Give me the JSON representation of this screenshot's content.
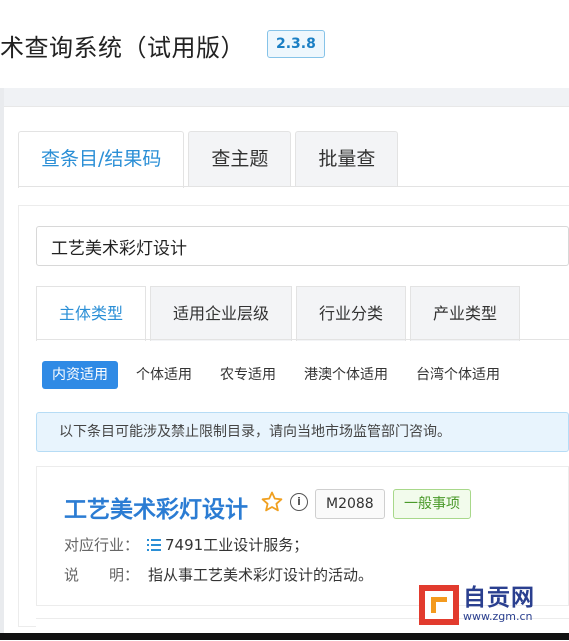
{
  "header": {
    "title": "术查询系统（试用版）",
    "version": "2.3.8"
  },
  "main_tabs": [
    {
      "label": "查条目/结果码",
      "active": true
    },
    {
      "label": "查主题",
      "active": false
    },
    {
      "label": "批量查",
      "active": false
    }
  ],
  "search": {
    "value": "工艺美术彩灯设计"
  },
  "sub_tabs": [
    {
      "label": "主体类型",
      "active": true
    },
    {
      "label": "适用企业层级",
      "active": false
    },
    {
      "label": "行业分类",
      "active": false
    },
    {
      "label": "产业类型",
      "active": false
    }
  ],
  "pills": [
    {
      "label": "内资适用",
      "active": true
    },
    {
      "label": "个体适用",
      "active": false
    },
    {
      "label": "农专适用",
      "active": false
    },
    {
      "label": "港澳个体适用",
      "active": false
    },
    {
      "label": "台湾个体适用",
      "active": false
    }
  ],
  "notice": "以下条目可能涉及禁止限制目录，请向当地市场监管部门咨询。",
  "result": {
    "title": "工艺美术彩灯设计",
    "info_glyph": "i",
    "code": "M2088",
    "type_badge": "一般事项",
    "industry_label": "对应行业：",
    "industry_value": "7491工业设计服务；",
    "desc_label": "说　　明：",
    "desc_value": "指从事工艺美术彩灯设计的活动。"
  },
  "watermark": {
    "name": "自贡网",
    "url": "www.zgm.cn"
  },
  "colors": {
    "accent": "#2b8fd6",
    "pill_active": "#2f8ae5",
    "title_blue": "#2b7cd3",
    "badge_green": "#4a9a2a"
  },
  "icons": {
    "favorite": "star-outline-icon",
    "info": "info-circle-icon",
    "industry": "list-icon"
  }
}
